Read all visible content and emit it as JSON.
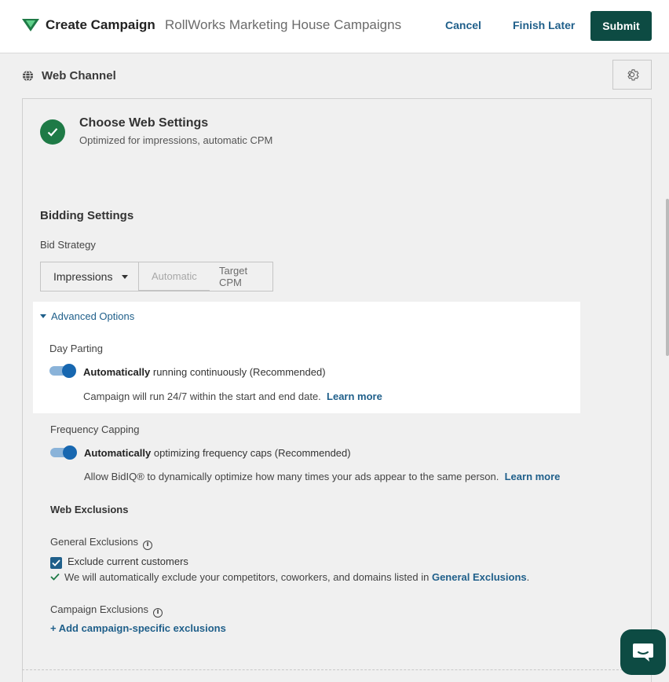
{
  "header": {
    "logo_icon": "rollworks-logo-icon",
    "title": "Create Campaign",
    "campaign_name": "RollWorks Marketing House Campaigns",
    "cancel_label": "Cancel",
    "finish_later_label": "Finish Later",
    "submit_label": "Submit"
  },
  "channel": {
    "icon": "globe-icon",
    "label": "Web Channel",
    "settings_icon": "gear-icon"
  },
  "step": {
    "status": "complete",
    "title": "Choose Web Settings",
    "subtitle": "Optimized for impressions, automatic CPM"
  },
  "bidding": {
    "title": "Bidding Settings",
    "strategy_label": "Bid Strategy",
    "strategy_value": "Impressions",
    "auto_placeholder": "Automatic",
    "target_label": "Target CPM"
  },
  "advanced": {
    "toggle_label": "Advanced Options",
    "expanded": true
  },
  "day_parting": {
    "label": "Day Parting",
    "enabled": true,
    "bold": "Automatically",
    "text": " running continuously (Recommended)",
    "desc": "Campaign will run 24/7 within the start and end date.",
    "learn_more": "Learn more"
  },
  "frequency": {
    "label": "Frequency Capping",
    "enabled": true,
    "bold": "Automatically",
    "text": " optimizing frequency caps (Recommended)",
    "desc": "Allow BidIQ® to dynamically optimize how many times your ads appear to the same person.",
    "learn_more": "Learn more"
  },
  "exclusions": {
    "title": "Web Exclusions",
    "general_label": "General Exclusions",
    "exclude_customers_label": "Exclude current customers",
    "exclude_customers_checked": true,
    "auto_exclude_text": "We will automatically exclude your competitors, coworkers, and domains listed in",
    "auto_exclude_link": "General Exclusions",
    "auto_exclude_end": ".",
    "campaign_label": "Campaign Exclusions",
    "add_link": "+ Add campaign-specific exclusions"
  },
  "chat": {
    "icon": "chat-icon"
  },
  "colors": {
    "brand_dark": "#0d4b43",
    "link": "#1f5f8a",
    "success": "#1e7a46",
    "toggle_on": "#1767b0"
  }
}
